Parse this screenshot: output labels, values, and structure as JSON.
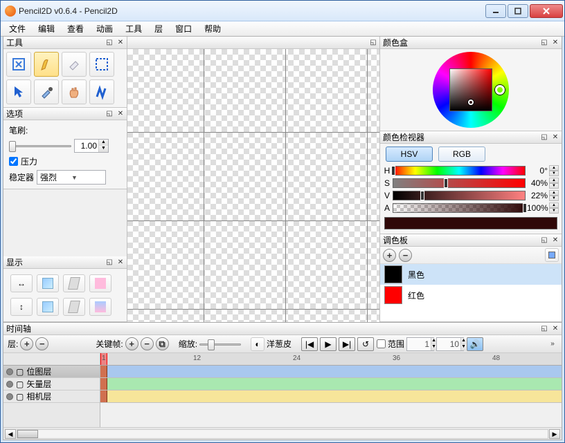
{
  "window": {
    "title": "Pencil2D v0.6.4 - Pencil2D"
  },
  "menu": [
    "文件",
    "编辑",
    "查看",
    "动画",
    "工具",
    "层",
    "窗口",
    "帮助"
  ],
  "panels": {
    "tools": "工具",
    "options": "选项",
    "display": "显示",
    "colorbox": "颜色盒",
    "colorinspector": "颜色检视器",
    "palette": "调色板",
    "timeline": "时间轴"
  },
  "options": {
    "brush_label": "笔刷:",
    "brush_value": "1.00",
    "pressure_label": "压力",
    "stabilizer_label": "稳定器",
    "stabilizer_value": "强烈"
  },
  "color": {
    "tab_hsv": "HSV",
    "tab_rgb": "RGB",
    "h": {
      "label": "H",
      "value": "0°",
      "pos": 0,
      "grad": "linear-gradient(to right,red,yellow,lime,cyan,blue,magenta,red)"
    },
    "s": {
      "label": "S",
      "value": "40%",
      "pos": 40,
      "grad": "linear-gradient(to right,#808080,#ff0000)"
    },
    "v": {
      "label": "V",
      "value": "22%",
      "pos": 22,
      "grad": "linear-gradient(to right,#000,#ff8080)"
    },
    "a": {
      "label": "A",
      "value": "100%",
      "pos": 100,
      "grad": "linear-gradient(to right,transparent,#2f0808),repeating-conic-gradient(#ccc 0 25%,#fff 0 50%) 0/10px 10px"
    },
    "swatch": "#2f0808"
  },
  "palette": {
    "items": [
      {
        "name": "黑色",
        "color": "#000000"
      },
      {
        "name": "红色",
        "color": "#ff0000"
      }
    ]
  },
  "timeline": {
    "layers_label": "层:",
    "keyframe_label": "关键帧:",
    "zoom_label": "缩放:",
    "onion_label": "洋葱皮",
    "range_label": "范围",
    "range_start": "1",
    "range_end": "10",
    "ticks": [
      1,
      12,
      24,
      36,
      48
    ],
    "layers": [
      {
        "name": "位图层",
        "color": "#a9c8ef"
      },
      {
        "name": "矢量层",
        "color": "#a9e8b0"
      },
      {
        "name": "相机层",
        "color": "#f7e59a"
      }
    ]
  }
}
